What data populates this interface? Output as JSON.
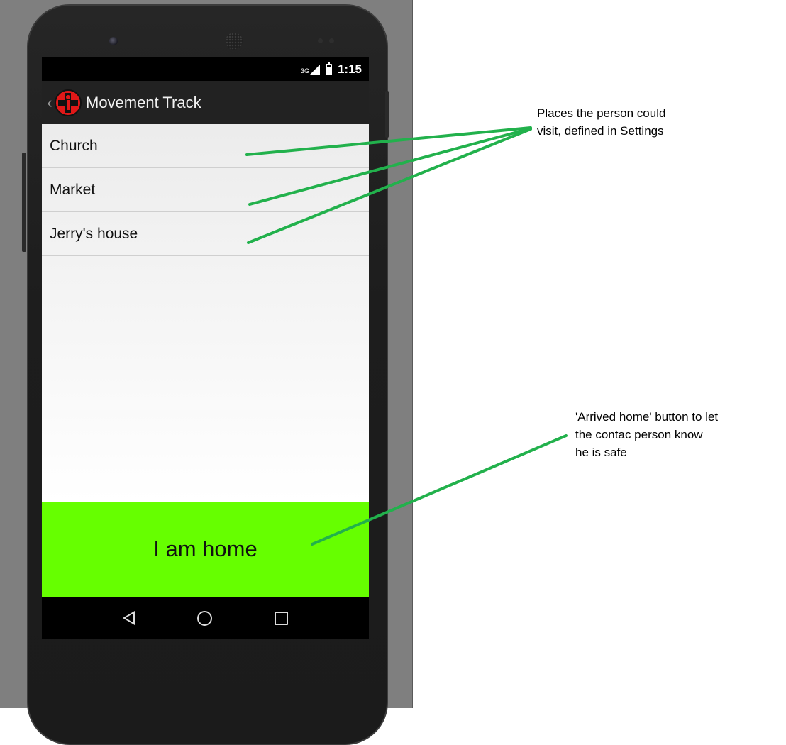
{
  "status_bar": {
    "network": "3G",
    "time": "1:15"
  },
  "action_bar": {
    "back_glyph": "‹",
    "logo_icon": "red-cross-person-icon",
    "title": "Movement Track"
  },
  "places": [
    {
      "label": "Church"
    },
    {
      "label": "Market"
    },
    {
      "label": "Jerry's house"
    }
  ],
  "home_button": {
    "label": "I am home",
    "color": "#66ff00"
  },
  "nav_bar": {
    "icons": [
      "back-icon",
      "home-icon",
      "recents-icon"
    ]
  },
  "annotations": {
    "places_note": [
      "Places the person could",
      "visit, defined in Settings"
    ],
    "home_note": [
      "'Arrived home' button to let",
      "the contac person know",
      "he is safe"
    ],
    "arrow_color": "#22b14c"
  }
}
